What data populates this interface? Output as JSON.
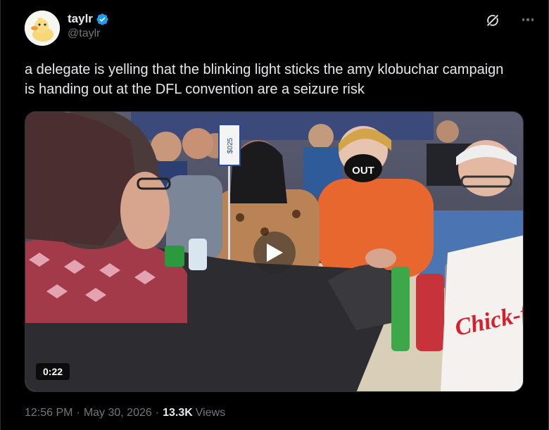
{
  "author": {
    "display_name": "taylr",
    "handle": "@taylr",
    "verified": true,
    "avatar_icon": "duck-avatar",
    "verified_color": "#1d9bf0"
  },
  "tweet": {
    "text": "a delegate is yelling that the blinking light sticks the amy klobuchar campaign is handing out at the DFL convention are a seizure risk"
  },
  "media": {
    "type": "video",
    "duration": "0:22",
    "sign_text": "$025",
    "mask_text": "OUT",
    "bag_text": "Chick-f"
  },
  "meta": {
    "time": "12:56 PM",
    "separator": "·",
    "date": "May 30, 2026",
    "views_count": "13.3K",
    "views_label": "Views"
  },
  "colors": {
    "background": "#000000",
    "text_primary": "#e7e9ea",
    "text_secondary": "#71767b"
  }
}
